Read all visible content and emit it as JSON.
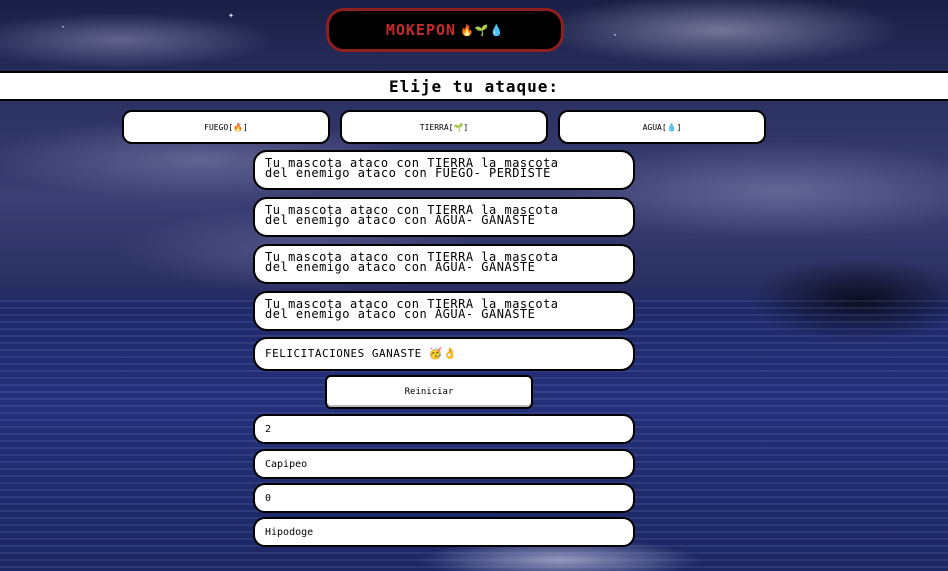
{
  "header": {
    "title": "MOKEPON",
    "title_emojis": "🔥🌱💧"
  },
  "section": {
    "heading": "Elije tu ataque:"
  },
  "attacks": [
    {
      "label": "FUEGO[🔥]"
    },
    {
      "label": "TIERRA[🌱]"
    },
    {
      "label": "AGUA[💧]"
    }
  ],
  "messages": [
    {
      "line1": "Tu mascota ataco con TIERRA la mascota",
      "line2": "del enemigo ataco con FUEGO- PERDISTE"
    },
    {
      "line1": "Tu mascota ataco con TIERRA la mascota",
      "line2": "del enemigo ataco con AGUA- GANASTE"
    },
    {
      "line1": "Tu mascota ataco con TIERRA la mascota",
      "line2": "del enemigo ataco con AGUA- GANASTE"
    },
    {
      "line1": "Tu mascota ataco con TIERRA la mascota",
      "line2": "del enemigo ataco con AGUA- GANASTE"
    }
  ],
  "final_message": "FELICITACIONES GANASTE 🥳👌",
  "restart_label": "Reiniciar",
  "stats": {
    "player_lives": "2",
    "player_pet": "Capipeo",
    "enemy_lives": "0",
    "enemy_pet": "Hipodoge"
  },
  "colors": {
    "title_text": "#c62a2a",
    "title_border": "#8f1e1e",
    "panel_bg": "#ffffff"
  }
}
